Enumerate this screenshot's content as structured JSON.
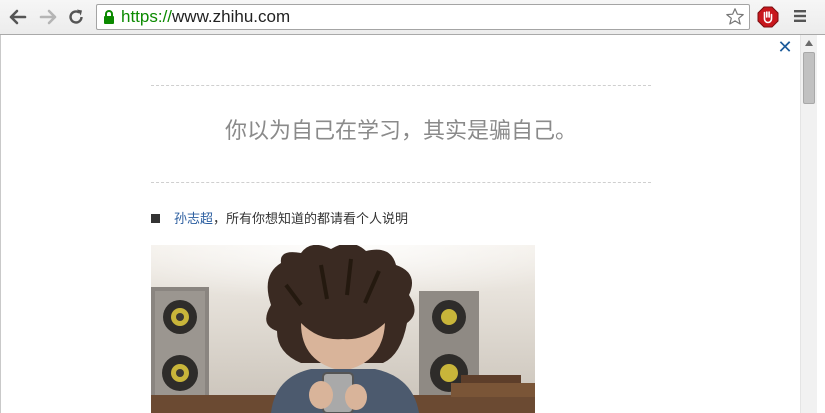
{
  "browser": {
    "url_scheme": "https://",
    "url_rest": "www.zhihu.com"
  },
  "page": {
    "quote": "你以为自己在学习，其实是骗自己。",
    "author_name": "孙志超",
    "author_desc": "，所有你想知道的都请看个人说明"
  },
  "colors": {
    "link": "#2a5d9f",
    "quote_text": "#8a8a8a",
    "https_green": "#0b8a00"
  }
}
